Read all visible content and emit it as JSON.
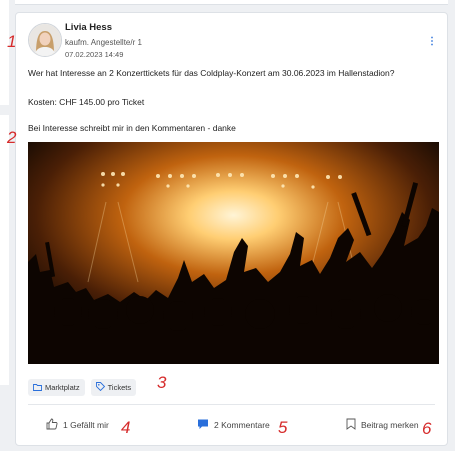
{
  "post": {
    "author": "Livia Hess",
    "role": "kaufm. Angestellte/r 1",
    "date": "07.02.2023 14:49",
    "lines": [
      "Wer hat Interesse an 2 Konzerttickets für das Coldplay-Konzert am 30.06.2023 im Hallenstadion?",
      "Kosten: CHF 145.00 pro Ticket",
      "Bei Interesse schreibt mir in den Kommentaren - danke"
    ],
    "more_icon": "⋮"
  },
  "tags": [
    "Marktplatz",
    "Tickets"
  ],
  "actions": {
    "like": "1 Gefällt mir",
    "comments": "2 Kommentare",
    "bookmark": "Beitrag merken"
  },
  "annotations": [
    "1",
    "2",
    "3",
    "4",
    "5",
    "6"
  ],
  "colors": {
    "accent": "#2a6fdb",
    "annotation": "#d62b2b"
  },
  "icons": [
    "folder-icon",
    "tag-icon",
    "thumbs-up-icon",
    "comment-icon",
    "bookmark-icon",
    "more-vertical-icon"
  ]
}
